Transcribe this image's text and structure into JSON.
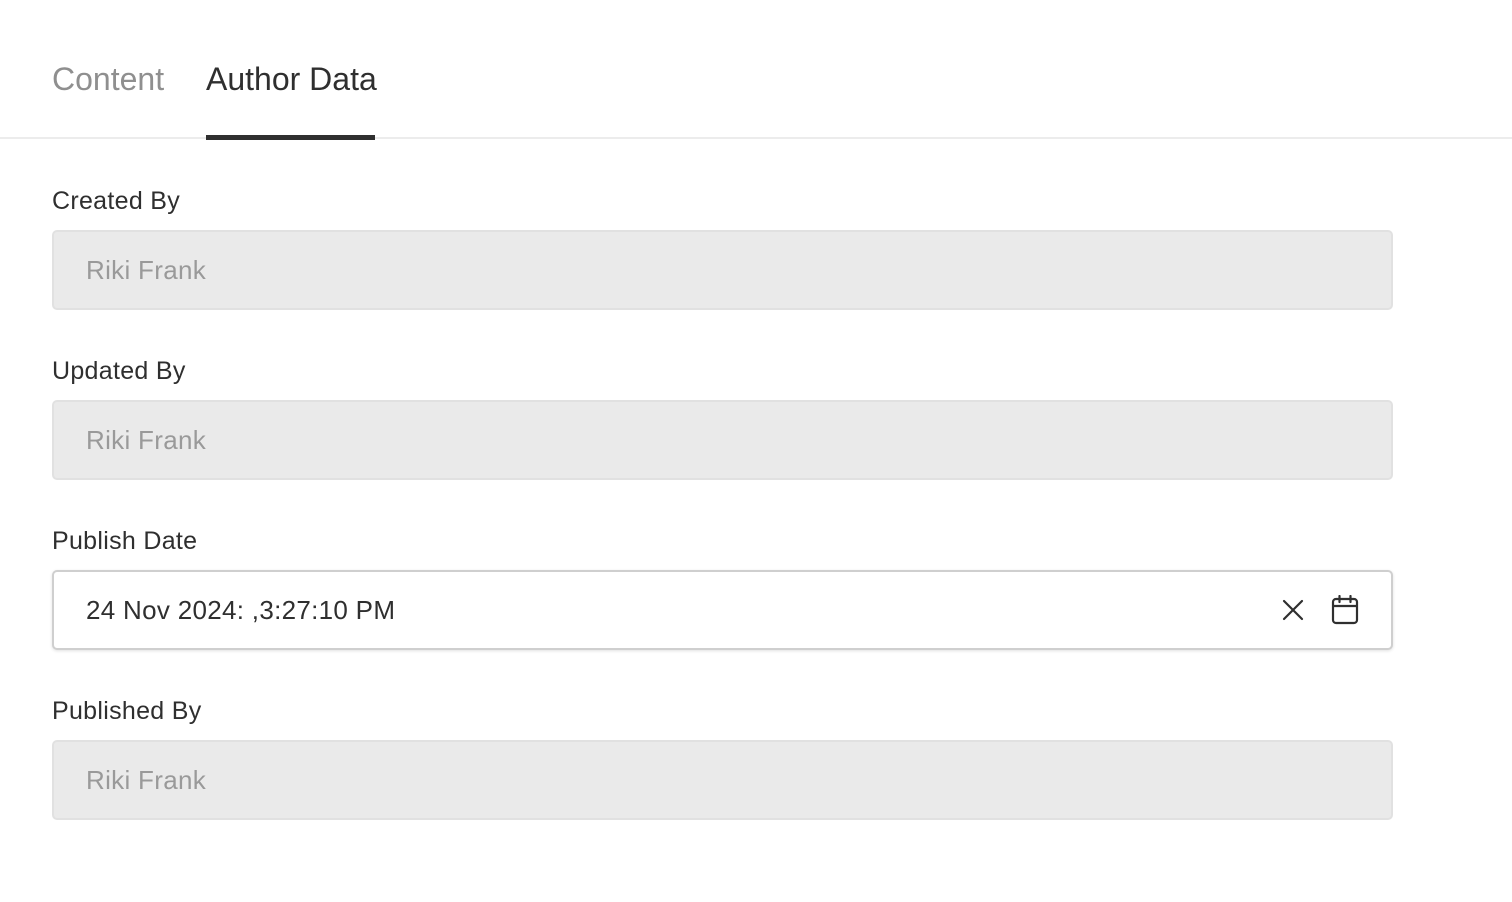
{
  "tabs": [
    {
      "label": "Content",
      "active": false
    },
    {
      "label": "Author Data",
      "active": true
    }
  ],
  "fields": {
    "created_by": {
      "label": "Created By",
      "value": "Riki Frank"
    },
    "updated_by": {
      "label": "Updated By",
      "value": "Riki Frank"
    },
    "publish_date": {
      "label": "Publish Date",
      "value": "24 Nov 2024: ,3:27:10 PM"
    },
    "published_by": {
      "label": "Published By",
      "value": "Riki Frank"
    }
  },
  "icons": {
    "clear": "close-icon",
    "calendar": "calendar-icon"
  },
  "colors": {
    "active_tab": "#2f2f2f",
    "inactive_tab": "#8f8f8f",
    "disabled_field_bg": "#eaeaea",
    "disabled_text": "#9a9a9a"
  }
}
